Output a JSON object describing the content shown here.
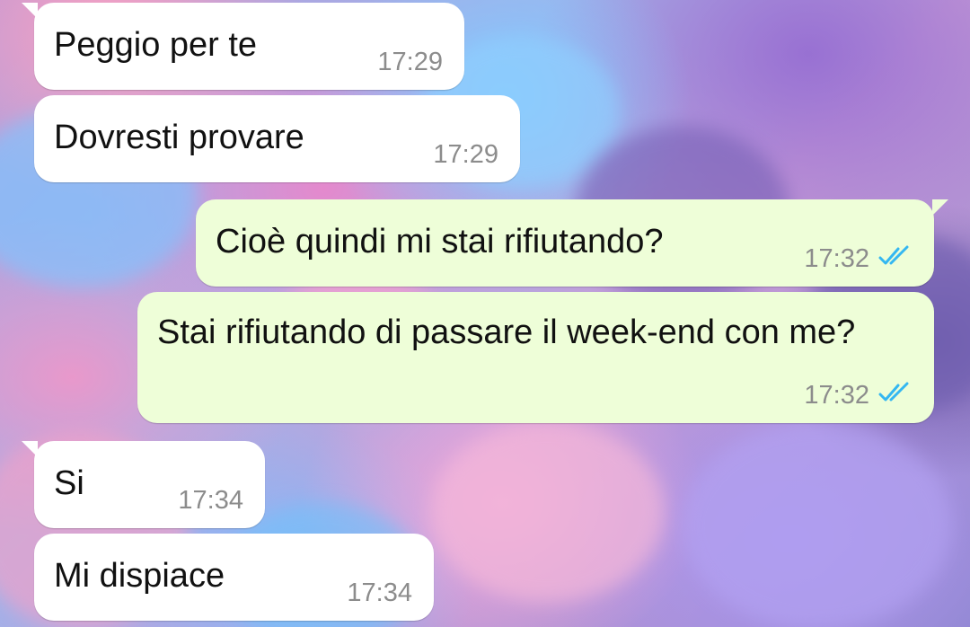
{
  "colors": {
    "incoming_bubble": "#ffffff",
    "outgoing_bubble": "#eefed8",
    "time_text": "#8c8c8c",
    "read_ticks": "#34b7f1"
  },
  "messages": [
    {
      "direction": "incoming",
      "text": "Peggio per te",
      "time": "17:29"
    },
    {
      "direction": "incoming",
      "text": "Dovresti provare",
      "time": "17:29"
    },
    {
      "direction": "outgoing",
      "text": "Cioè quindi mi stai rifiutando?",
      "time": "17:32",
      "status_icon": "double-check-read-icon"
    },
    {
      "direction": "outgoing",
      "text": "Stai rifiutando di passare il week-end con me?",
      "time": "17:32",
      "status_icon": "double-check-read-icon"
    },
    {
      "direction": "incoming",
      "text": "Si",
      "time": "17:34"
    },
    {
      "direction": "incoming",
      "text": "Mi dispiace",
      "time": "17:34"
    }
  ]
}
